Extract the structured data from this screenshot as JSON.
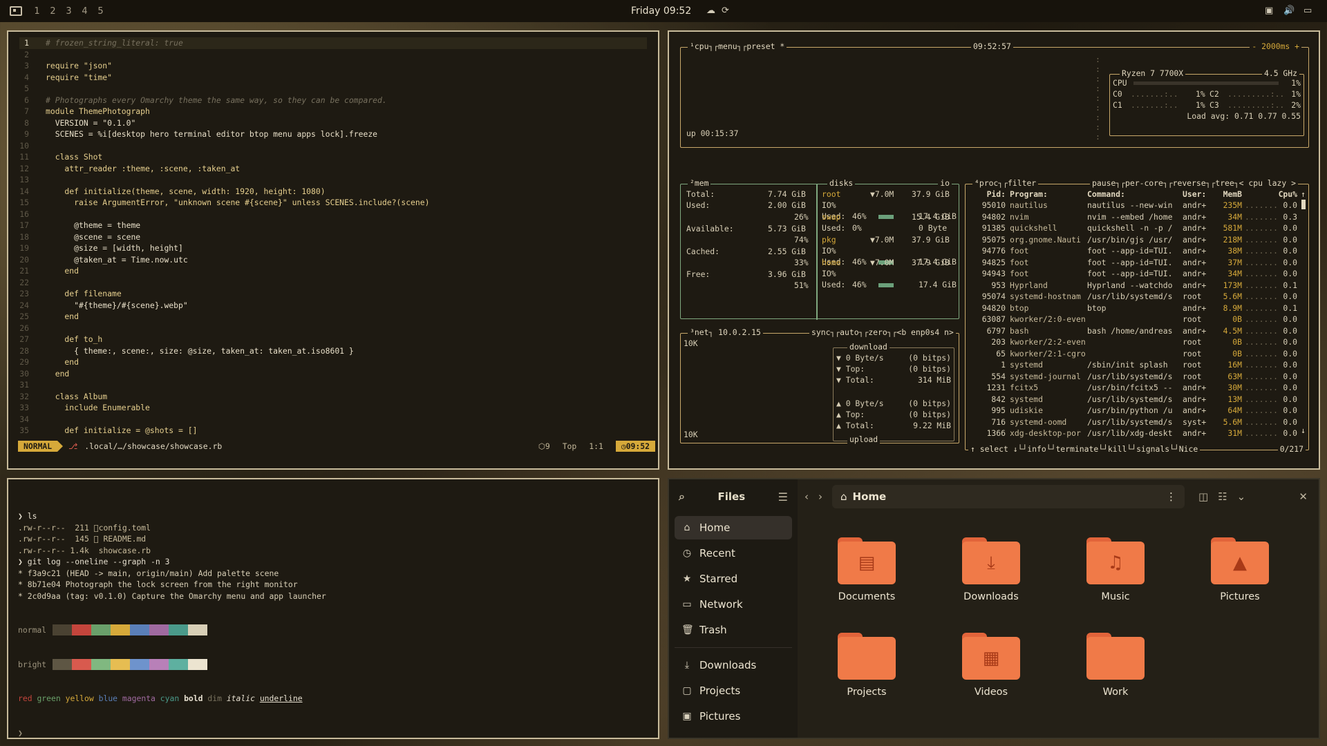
{
  "topbar": {
    "workspaces": [
      "1",
      "2",
      "3",
      "4",
      "5"
    ],
    "clock": "Friday 09:52"
  },
  "editor": {
    "lines": [
      {
        "n": "1",
        "t": "# frozen_string_literal: true"
      },
      {
        "n": "2",
        "t": ""
      },
      {
        "n": "3",
        "t": "require \"json\""
      },
      {
        "n": "4",
        "t": "require \"time\""
      },
      {
        "n": "5",
        "t": ""
      },
      {
        "n": "6",
        "t": "# Photographs every Omarchy theme the same way, so they can be compared."
      },
      {
        "n": "7",
        "t": "module ThemePhotograph"
      },
      {
        "n": "8",
        "t": "  VERSION = \"0.1.0\""
      },
      {
        "n": "9",
        "t": "  SCENES = %i[desktop hero terminal editor btop menu apps lock].freeze"
      },
      {
        "n": "10",
        "t": ""
      },
      {
        "n": "11",
        "t": "  class Shot"
      },
      {
        "n": "12",
        "t": "    attr_reader :theme, :scene, :taken_at"
      },
      {
        "n": "13",
        "t": ""
      },
      {
        "n": "14",
        "t": "    def initialize(theme, scene, width: 1920, height: 1080)"
      },
      {
        "n": "15",
        "t": "      raise ArgumentError, \"unknown scene #{scene}\" unless SCENES.include?(scene)"
      },
      {
        "n": "16",
        "t": ""
      },
      {
        "n": "17",
        "t": "      @theme = theme"
      },
      {
        "n": "18",
        "t": "      @scene = scene"
      },
      {
        "n": "19",
        "t": "      @size = [width, height]"
      },
      {
        "n": "20",
        "t": "      @taken_at = Time.now.utc"
      },
      {
        "n": "21",
        "t": "    end"
      },
      {
        "n": "22",
        "t": ""
      },
      {
        "n": "23",
        "t": "    def filename"
      },
      {
        "n": "24",
        "t": "      \"#{theme}/#{scene}.webp\""
      },
      {
        "n": "25",
        "t": "    end"
      },
      {
        "n": "26",
        "t": ""
      },
      {
        "n": "27",
        "t": "    def to_h"
      },
      {
        "n": "28",
        "t": "      { theme:, scene:, size: @size, taken_at: taken_at.iso8601 }"
      },
      {
        "n": "29",
        "t": "    end"
      },
      {
        "n": "30",
        "t": "  end"
      },
      {
        "n": "31",
        "t": ""
      },
      {
        "n": "32",
        "t": "  class Album"
      },
      {
        "n": "33",
        "t": "    include Enumerable"
      },
      {
        "n": "34",
        "t": ""
      },
      {
        "n": "35",
        "t": "    def initialize = @shots = []"
      }
    ],
    "status": {
      "mode": "NORMAL",
      "path": ".local/…/showcase/showcase.rb",
      "lsp": "9",
      "pos_label": "Top",
      "cursor": "1:1",
      "time": "09:52"
    }
  },
  "btop": {
    "cpu": {
      "title": "¹cpu",
      "menu": "menu",
      "preset": "preset *",
      "clock": "09:52:57",
      "rate": "- 2000ms +",
      "model": "Ryzen 7 7700X",
      "freq": "4.5 GHz",
      "rows": [
        {
          "label": "CPU",
          "val": "1%"
        },
        {
          "label": "C0",
          "val": "1%"
        },
        {
          "label": "C2",
          "val": "1%"
        },
        {
          "label": "C1",
          "val": "1%"
        },
        {
          "label": "C3",
          "val": "2%"
        }
      ],
      "load": "Load avg: 0.71 0.77 0.55",
      "uptime": "up 00:15:37"
    },
    "mem": {
      "title": "²mem",
      "total": "7.74 GiB",
      "used": "2.00 GiB",
      "used_pct": "26%",
      "avail": "5.73 GiB",
      "avail_pct": "74%",
      "cached": "2.55 GiB",
      "cached_pct": "33%",
      "free": "3.96 GiB",
      "free_pct": "51%",
      "labels": {
        "total": "Total:",
        "used": "Used:",
        "available": "Available:",
        "cached": "Cached:",
        "free": "Free:"
      }
    },
    "disks": {
      "title": "disks",
      "io": "io",
      "items": [
        {
          "name": "root",
          "io": "▼7.0M",
          "size": "37.9 GiB",
          "used": "46%",
          "used_size": "17.4 GiB"
        },
        {
          "name": "swap",
          "io": "",
          "size": "15.4 GiB",
          "used": "0%",
          "used_size": "0 Byte"
        },
        {
          "name": "pkg",
          "io": "▼7.0M",
          "size": "37.9 GiB",
          "used": "46%",
          "used_size": "17.4 GiB"
        },
        {
          "name": "home",
          "io": "▼7.0M",
          "size": "37.9 GiB",
          "used": "46%",
          "used_size": "17.4 GiB"
        }
      ],
      "io_label": "IO%",
      "used_label": "Used:"
    },
    "net": {
      "title": "³net",
      "ip": "10.0.2.15",
      "sync": "sync",
      "auto": "auto",
      "zero": "zero",
      "iface": "<b enp0s4 n>",
      "scale_top": "10K",
      "scale_bottom": "10K",
      "download": "download",
      "upload": "upload",
      "rx": [
        {
          "k": "▼ 0 Byte/s",
          "v": "(0 bitps)"
        },
        {
          "k": "▼ Top:",
          "v": "(0 bitps)"
        },
        {
          "k": "▼ Total:",
          "v": "314 MiB"
        }
      ],
      "tx": [
        {
          "k": "▲ 0 Byte/s",
          "v": "(0 bitps)"
        },
        {
          "k": "▲ Top:",
          "v": "(0 bitps)"
        },
        {
          "k": "▲ Total:",
          "v": "9.22 MiB"
        }
      ]
    },
    "proc": {
      "title": "⁴proc",
      "filter": "filter",
      "pause": "pause",
      "percore": "per-core",
      "reverse": "reverse",
      "tree": "tree",
      "sort": "< cpu lazy >",
      "headers": {
        "pid": "Pid:",
        "prog": "Program:",
        "cmd": "Command:",
        "user": "User:",
        "mem": "MemB",
        "cpu": "Cpu%"
      },
      "rows": [
        [
          "95010",
          "nautilus",
          "nautilus --new-win",
          "andr+",
          "235M",
          "0.0"
        ],
        [
          "94802",
          "nvim",
          "nvim --embed /home",
          "andr+",
          "34M",
          "0.3"
        ],
        [
          "91385",
          "quickshell",
          "quickshell -n -p /",
          "andr+",
          "581M",
          "0.0"
        ],
        [
          "95075",
          "org.gnome.Nauti",
          "/usr/bin/gjs /usr/",
          "andr+",
          "218M",
          "0.0"
        ],
        [
          "94776",
          "foot",
          "foot --app-id=TUI.",
          "andr+",
          "38M",
          "0.0"
        ],
        [
          "94825",
          "foot",
          "foot --app-id=TUI.",
          "andr+",
          "37M",
          "0.0"
        ],
        [
          "94943",
          "foot",
          "foot --app-id=TUI.",
          "andr+",
          "34M",
          "0.0"
        ],
        [
          "953",
          "Hyprland",
          "Hyprland --watchdo",
          "andr+",
          "173M",
          "0.1"
        ],
        [
          "95074",
          "systemd-hostnam",
          "/usr/lib/systemd/s",
          "root",
          "5.6M",
          "0.0"
        ],
        [
          "94820",
          "btop",
          "btop",
          "andr+",
          "8.9M",
          "0.1"
        ],
        [
          "63087",
          "kworker/2:0-even",
          "",
          "root",
          "0B",
          "0.0"
        ],
        [
          "6797",
          "bash",
          "bash /home/andreas",
          "andr+",
          "4.5M",
          "0.0"
        ],
        [
          "203",
          "kworker/2:2-even",
          "",
          "root",
          "0B",
          "0.0"
        ],
        [
          "65",
          "kworker/2:1-cgro",
          "",
          "root",
          "0B",
          "0.0"
        ],
        [
          "1",
          "systemd",
          "/sbin/init splash",
          "root",
          "16M",
          "0.0"
        ],
        [
          "554",
          "systemd-journal",
          "/usr/lib/systemd/s",
          "root",
          "63M",
          "0.0"
        ],
        [
          "1231",
          "fcitx5",
          "/usr/bin/fcitx5 --",
          "andr+",
          "30M",
          "0.0"
        ],
        [
          "842",
          "systemd",
          "/usr/lib/systemd/s",
          "andr+",
          "13M",
          "0.0"
        ],
        [
          "995",
          "udiskie",
          "/usr/bin/python /u",
          "andr+",
          "64M",
          "0.0"
        ],
        [
          "716",
          "systemd-oomd",
          "/usr/lib/systemd/s",
          "syst+",
          "5.6M",
          "0.0"
        ],
        [
          "1366",
          "xdg-desktop-por",
          "/usr/lib/xdg-deskt",
          "andr+",
          "31M",
          "0.0"
        ]
      ],
      "footer": {
        "select": "↑ select ↓",
        "info": "info",
        "terminate": "terminate",
        "kill": "kill",
        "signals": "signals",
        "nice": "Nice",
        "count": "0/217"
      }
    }
  },
  "term": {
    "lines": [
      {
        "t": "❯ ls"
      },
      {
        "t": ".rw-r--r--  211 󰈙config.toml"
      },
      {
        "t": ".rw-r--r--  145 󰂺 README.md"
      },
      {
        "t": ".rw-r--r-- 1.4k  showcase.rb"
      },
      {
        "t": "❯ git log --oneline --graph -n 3"
      },
      {
        "t": "* f3a9c21 (HEAD -> main, origin/main) Add palette scene"
      },
      {
        "t": "* 8b71e04 Photograph the lock screen from the right monitor"
      },
      {
        "t": "* 2c0d9aa (tag: v0.1.0) Capture the Omarchy menu and app launcher"
      }
    ],
    "normal": "normal",
    "bright": "bright",
    "palette_normal": [
      "#4a4232",
      "#c4453c",
      "#6aa06a",
      "#d6a93a",
      "#5a7fb8",
      "#a06aa0",
      "#4a9a8a",
      "#d8cfb6"
    ],
    "palette_bright": [
      "#5e5644",
      "#d85a4e",
      "#80b880",
      "#e6bd52",
      "#6e93cc",
      "#b880b8",
      "#5eb0a0",
      "#ece4d0"
    ],
    "styles": {
      "red": "red",
      "green": "green",
      "yellow": "yellow",
      "blue": "blue",
      "magenta": "magenta",
      "cyan": "cyan",
      "bold": "bold",
      "dim": "dim",
      "italic": "italic",
      "underline": "underline"
    },
    "prompt": "❯"
  },
  "files": {
    "title": "Files",
    "sidebar": [
      {
        "label": "Home",
        "icon": "home-icon",
        "glyph": "⌂",
        "active": true
      },
      {
        "label": "Recent",
        "icon": "clock-icon",
        "glyph": "◷"
      },
      {
        "label": "Starred",
        "icon": "star-icon",
        "glyph": "★"
      },
      {
        "label": "Network",
        "icon": "network-icon",
        "glyph": "▭"
      },
      {
        "label": "Trash",
        "icon": "trash-icon",
        "glyph": "🗑"
      }
    ],
    "bookmarks": [
      {
        "label": "Downloads",
        "icon": "download-icon",
        "glyph": "⤓"
      },
      {
        "label": "Projects",
        "icon": "folder-icon",
        "glyph": "▢"
      },
      {
        "label": "Pictures",
        "icon": "image-icon",
        "glyph": "▣"
      }
    ],
    "path": "Home",
    "folders": [
      {
        "label": "Documents",
        "glyph": "▤"
      },
      {
        "label": "Downloads",
        "glyph": "⤓"
      },
      {
        "label": "Music",
        "glyph": "♫"
      },
      {
        "label": "Pictures",
        "glyph": "▲"
      },
      {
        "label": "Projects",
        "glyph": ""
      },
      {
        "label": "Videos",
        "glyph": "▦"
      },
      {
        "label": "Work",
        "glyph": ""
      }
    ]
  }
}
